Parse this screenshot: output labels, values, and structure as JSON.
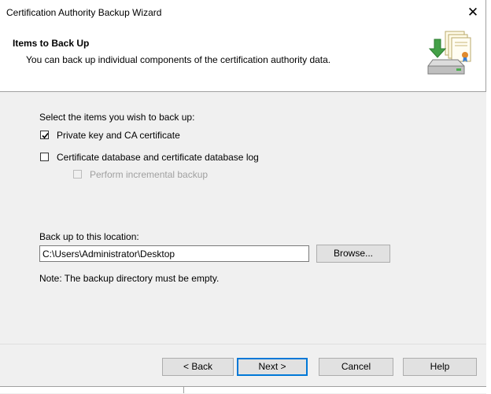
{
  "window": {
    "title": "Certification Authority Backup Wizard",
    "close_glyph": "✕"
  },
  "header": {
    "title": "Items to Back Up",
    "subtitle": "You can back up individual components of the certification authority data.",
    "icon": "backup-certificates-icon"
  },
  "content": {
    "select_label": "Select the items you wish to back up:",
    "options": [
      {
        "label": "Private key and CA certificate",
        "checked": true,
        "enabled": true
      },
      {
        "label": "Certificate database and certificate database log",
        "checked": false,
        "enabled": true
      },
      {
        "label": "Perform incremental backup",
        "checked": false,
        "enabled": false
      }
    ],
    "location_label": "Back up to this location:",
    "location_value": "C:\\Users\\Administrator\\Desktop",
    "browse_label": "Browse...",
    "note": "Note: The backup directory must be empty."
  },
  "footer": {
    "back_label": "< Back",
    "next_label": "Next >",
    "cancel_label": "Cancel",
    "help_label": "Help"
  },
  "colors": {
    "accent": "#0078d7",
    "panel": "#f0f0f0",
    "button": "#e1e1e1",
    "disabled_text": "#a0a0a0"
  }
}
